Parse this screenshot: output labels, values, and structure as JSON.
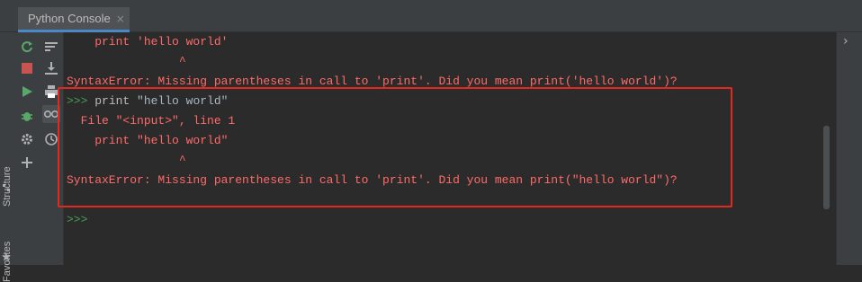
{
  "tab": {
    "title": "Python Console",
    "close_glyph": "×"
  },
  "left_strip": {
    "structure_label": "Structure",
    "favorites_label": "Favorites"
  },
  "toolbar": {
    "left_icons": [
      "rerun-icon",
      "stop-icon",
      "run-icon",
      "debug-icon",
      "settings-icon",
      "add-icon"
    ],
    "right_icons": [
      "soft-wrap-icon",
      "scroll-to-end-icon",
      "print-icon",
      "show-variables-icon",
      "history-icon"
    ]
  },
  "console": {
    "lines": [
      {
        "kind": "error",
        "text": "    print 'hello world'"
      },
      {
        "kind": "error",
        "text": "                ^"
      },
      {
        "kind": "error",
        "text": "SyntaxError: Missing parentheses in call to 'print'. Did you mean print('hello world')?"
      },
      {
        "kind": "input",
        "prompt": ">>> ",
        "command": "print ",
        "string": "\"hello world\""
      },
      {
        "kind": "error",
        "text": "  File \"<input>\", line 1"
      },
      {
        "kind": "error",
        "text": "    print \"hello world\""
      },
      {
        "kind": "error",
        "text": "                ^"
      },
      {
        "kind": "error",
        "text": "SyntaxError: Missing parentheses in call to 'print'. Did you mean print(\"hello world\")?"
      },
      {
        "kind": "blank",
        "text": ""
      },
      {
        "kind": "prompt",
        "prompt": ">>>"
      }
    ]
  },
  "colors": {
    "error": "#ff6b68",
    "prompt": "#499c54",
    "highlight_box": "#e3281d",
    "tab_underline": "#4a88c7"
  }
}
